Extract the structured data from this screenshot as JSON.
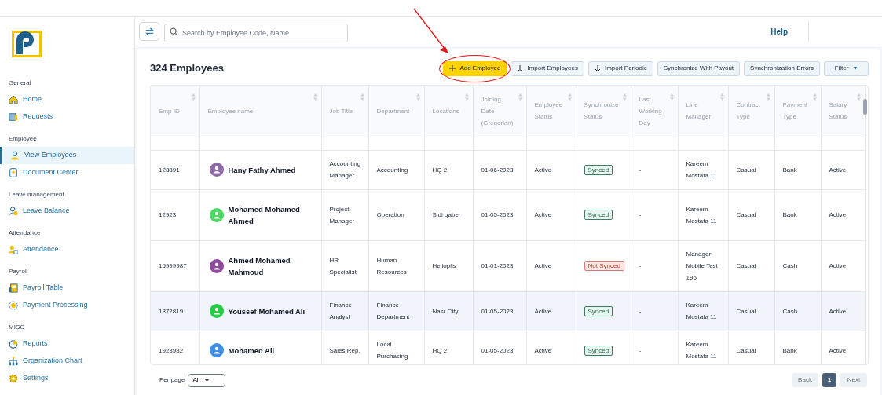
{
  "sidebar": {
    "sections": [
      {
        "title": "General",
        "items": [
          {
            "label": "Home",
            "kind": "home",
            "selected": false
          },
          {
            "label": "Requests",
            "kind": "requests",
            "selected": false
          }
        ]
      },
      {
        "title": "Employee",
        "items": [
          {
            "label": "View Employees",
            "kind": "person",
            "selected": true
          },
          {
            "label": "Document Center",
            "kind": "document",
            "selected": false
          }
        ]
      },
      {
        "title": "Leave management",
        "items": [
          {
            "label": "Leave Balance",
            "kind": "leave",
            "selected": false
          }
        ]
      },
      {
        "title": "Attendance",
        "items": [
          {
            "label": "Attendance",
            "kind": "attendance",
            "selected": false
          }
        ]
      },
      {
        "title": "Payroll",
        "items": [
          {
            "label": "Payroll Table",
            "kind": "ledger",
            "selected": false
          },
          {
            "label": "Payment Processing",
            "kind": "payment",
            "selected": false
          }
        ]
      },
      {
        "title": "MISC",
        "items": [
          {
            "label": "Reports",
            "kind": "reports",
            "selected": false
          },
          {
            "label": "Organization Chart",
            "kind": "org",
            "selected": false
          },
          {
            "label": "Settings",
            "kind": "settings",
            "selected": false
          }
        ]
      }
    ]
  },
  "topbar": {
    "search": {
      "placeholder": "Search by Employee Code, Name"
    },
    "help": "Help"
  },
  "page": {
    "title": "324 Employees",
    "actions": [
      {
        "label": "Add Employee",
        "kind": "primary",
        "highlighted": true
      },
      {
        "label": "Import Employees",
        "kind": "import",
        "highlighted": false
      },
      {
        "label": "Import Periodic",
        "kind": "import",
        "highlighted": false
      },
      {
        "label": "Synchronize With Payout",
        "kind": "plain",
        "highlighted": false
      },
      {
        "label": "Synchronization Errors",
        "kind": "plain",
        "highlighted": false
      },
      {
        "label": "Filter",
        "kind": "dropdown",
        "caret": "▼",
        "highlighted": false
      }
    ]
  },
  "table": {
    "columns": [
      "Emp ID",
      "Employee name",
      "Job Title",
      "Department",
      "Locations",
      "Joining Date (Gregorian)",
      "Employee Status",
      "Synchronize Status",
      "Last Working Day",
      "Line Manager",
      "Contract Type",
      "Payment Type",
      "Salary Status"
    ],
    "rows": [
      {
        "emp_id": "123891",
        "name": "Hany Fathy Ahmed",
        "color": "#8e6aa6",
        "job_title": "Accounting Manager",
        "department": "Accounting",
        "location": "HQ 2",
        "joining_date": "01-06-2023",
        "employee_status": "Active",
        "sync": {
          "label": "Synced",
          "kind": "ok"
        },
        "last_working_day": "-",
        "line_manager": "Kareem Mostafa 11",
        "contract_type": "Casual",
        "payment_type": "Bank",
        "salary_status": "Active",
        "selected": false
      },
      {
        "emp_id": "12923",
        "name": "Mohamed Mohamed Ahmed",
        "color": "#4cd964",
        "job_title": "Project Manager",
        "department": "Operation",
        "location": "Sidi gaber",
        "joining_date": "01-05-2023",
        "employee_status": "Active",
        "sync": {
          "label": "Synced",
          "kind": "ok"
        },
        "last_working_day": "-",
        "line_manager": "Kareem Mostafa 11",
        "contract_type": "Casual",
        "payment_type": "Bank",
        "salary_status": "Active",
        "selected": false
      },
      {
        "emp_id": "15999987",
        "name": "Ahmed Mohamed Mahmoud",
        "color": "#8e4a9c",
        "job_title": "HR Specialist",
        "department": "Human Resources",
        "location": "Helioplis",
        "joining_date": "01-01-2023",
        "employee_status": "Active",
        "sync": {
          "label": "Not Synced",
          "kind": "error"
        },
        "last_working_day": "-",
        "line_manager": "Manager Mobile Test 196",
        "contract_type": "Casual",
        "payment_type": "Cash",
        "salary_status": "Active",
        "selected": false
      },
      {
        "emp_id": "1872819",
        "name": "Youssef Mohamed Ali",
        "color": "#22cc44",
        "job_title": "Finance Analyst",
        "department": "Finance Department",
        "location": "Nasr City",
        "joining_date": "01-05-2023",
        "employee_status": "Active",
        "sync": {
          "label": "Synced",
          "kind": "ok"
        },
        "last_working_day": "-",
        "line_manager": "Kareem Mostafa 11",
        "contract_type": "Casual",
        "payment_type": "Cash",
        "salary_status": "Active",
        "selected": true
      },
      {
        "emp_id": "1923982",
        "name": "Mohamed Ali",
        "color": "#3d8fe8",
        "job_title": "Sales Rep.",
        "department": "Local Purchasing",
        "location": "HQ 2",
        "joining_date": "01-05-2023",
        "employee_status": "Active",
        "sync": {
          "label": "Synced",
          "kind": "ok"
        },
        "last_working_day": "-",
        "line_manager": "Kareem Mostafa 11",
        "contract_type": "Casual",
        "payment_type": "Bank",
        "salary_status": "Active",
        "selected": false
      }
    ]
  },
  "footer": {
    "per_page_label": "Per page",
    "per_page_value": "All",
    "pagination": [
      {
        "label": "Back",
        "selected": false,
        "disabled": true
      },
      {
        "label": "1",
        "selected": true,
        "disabled": false
      },
      {
        "label": "Next",
        "selected": false,
        "disabled": true
      }
    ]
  }
}
